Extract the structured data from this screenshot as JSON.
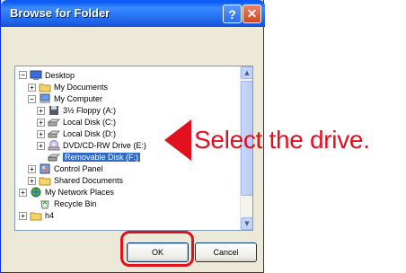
{
  "window": {
    "title": "Browse for Folder",
    "help_label": "?",
    "close_label": "✕"
  },
  "tree": {
    "items": [
      {
        "label": "Desktop",
        "icon": "desktop-icon",
        "expander": "−"
      },
      {
        "label": "My Documents",
        "icon": "folder-icon",
        "expander": "+"
      },
      {
        "label": "My Computer",
        "icon": "computer-icon",
        "expander": "−"
      },
      {
        "label": "3½ Floppy (A:)",
        "icon": "floppy-icon",
        "expander": "+"
      },
      {
        "label": "Local Disk (C:)",
        "icon": "drive-icon",
        "expander": "+"
      },
      {
        "label": "Local Disk (D:)",
        "icon": "drive-icon",
        "expander": "+"
      },
      {
        "label": "DVD/CD-RW Drive (E:)",
        "icon": "cd-drive-icon",
        "expander": "+"
      },
      {
        "label": "Removable Disk (F:)",
        "icon": "removable-disk-icon",
        "expander": "",
        "selected": true
      },
      {
        "label": "Control Panel",
        "icon": "control-panel-icon",
        "expander": "+"
      },
      {
        "label": "Shared Documents",
        "icon": "folder-icon",
        "expander": "+"
      },
      {
        "label": "My Network Places",
        "icon": "network-icon",
        "expander": "+"
      },
      {
        "label": "Recycle Bin",
        "icon": "recycle-bin-icon",
        "expander": ""
      },
      {
        "label": "h4",
        "icon": "folder-icon",
        "expander": "+"
      }
    ]
  },
  "buttons": {
    "ok_label": "OK",
    "cancel_label": "Cancel"
  },
  "annotation": {
    "text": "Select the drive.",
    "color": "#e0101e"
  },
  "colors": {
    "titlebar": "#2b77f5",
    "selection": "#316ac5",
    "dialog_bg": "#ece9d8"
  }
}
